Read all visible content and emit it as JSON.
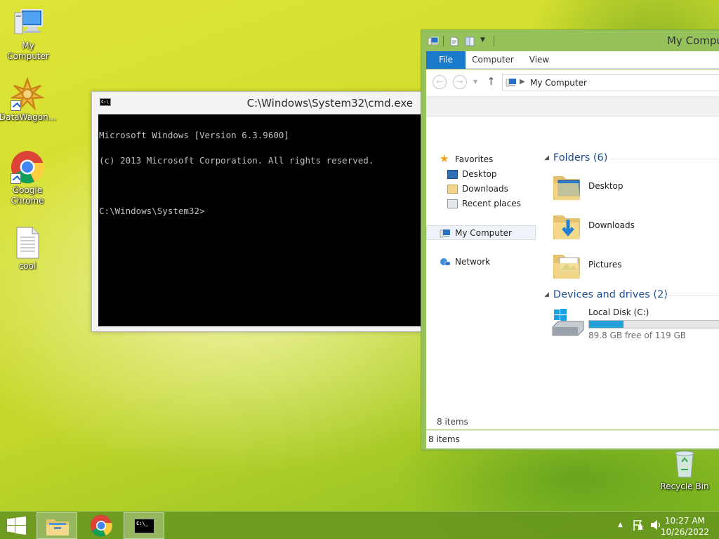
{
  "desktop": {
    "icons": [
      {
        "label": "My Computer",
        "icon": "computer-icon"
      },
      {
        "label": "DataWagon...",
        "icon": "datawagon-icon"
      },
      {
        "label": "Google\nChrome",
        "icon": "chrome-icon"
      },
      {
        "label": "cool",
        "icon": "text-file-icon"
      },
      {
        "label": "Recycle Bin",
        "icon": "recycle-bin-icon"
      }
    ]
  },
  "cmd": {
    "title": "C:\\Windows\\System32\\cmd.exe",
    "lines": [
      "Microsoft Windows [Version 6.3.9600]",
      "(c) 2013 Microsoft Corporation. All rights reserved.",
      "",
      "C:\\Windows\\System32>"
    ]
  },
  "explorer": {
    "title": "My Comput",
    "tabs": {
      "file": "File",
      "computer": "Computer",
      "view": "View"
    },
    "address": "My Computer",
    "nav": {
      "favorites": "Favorites",
      "desktop": "Desktop",
      "downloads": "Downloads",
      "recent": "Recent places",
      "my_computer": "My Computer",
      "network": "Network"
    },
    "folders_header": "Folders (6)",
    "folders": [
      "Desktop",
      "Downloads",
      "Pictures"
    ],
    "devices_header": "Devices and drives (2)",
    "drive": {
      "name": "Local Disk (C:)",
      "free_text": "89.8 GB free of 119 GB",
      "used_fraction": 0.245
    },
    "items_inner": "8 items",
    "status": "8 items"
  },
  "taskbar": {
    "time": "10:27 AM",
    "date": "10/26/2022"
  },
  "colors": {
    "accent": "#1979ca",
    "drive_bar": "#26a0da",
    "taskbar": "#65951f"
  }
}
